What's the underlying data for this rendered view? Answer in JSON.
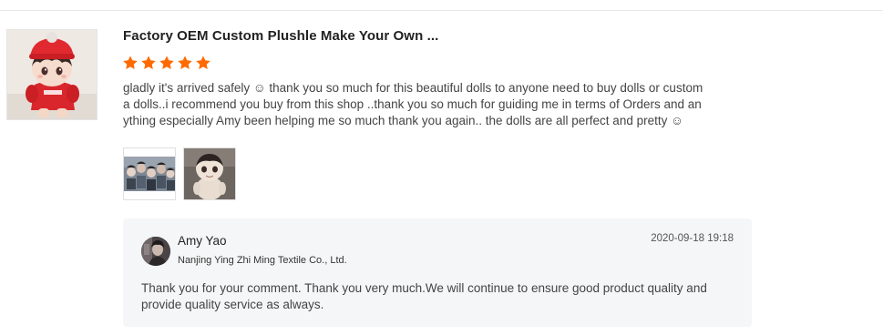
{
  "review": {
    "product_title": "Factory OEM Custom Plushle Make Your Own ...",
    "rating": 5,
    "rating_max": 5,
    "star_color": "#ff6a00",
    "text_lines": [
      "gladly it's arrived safely ☺ thank you so much for this beautiful dolls to anyone need to buy dolls or custom",
      "a dolls..i recommend you buy from this shop ..thank you so much for guiding me in terms of Orders and an",
      "ything especially Amy been helping me so much thank you again.. the dolls are all perfect and pretty ☺"
    ],
    "photos": [
      {
        "icon": "group-dolls-photo"
      },
      {
        "icon": "single-doll-photo"
      }
    ]
  },
  "reply": {
    "name": "Amy Yao",
    "company": "Nanjing Ying Zhi Ming Textile Co., Ltd.",
    "date": "2020-09-18 19:18",
    "text_lines": [
      "Thank you for your comment. Thank you very much.We will continue to ensure good product quality and",
      "provide quality service as always."
    ]
  }
}
